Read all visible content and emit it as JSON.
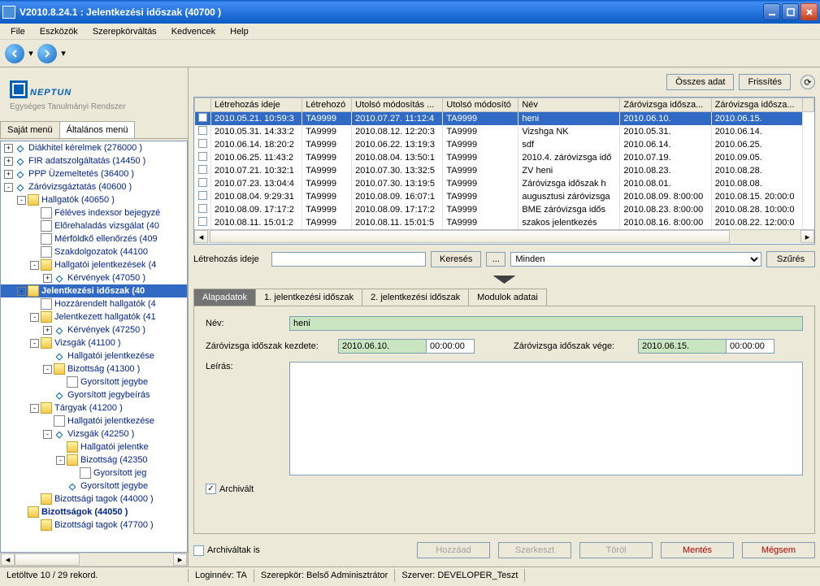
{
  "titlebar": {
    "title": "V2010.8.24.1 : Jelentkezési időszak (40700  )"
  },
  "menu": [
    "File",
    "Eszközök",
    "Szerepkörváltás",
    "Kedvencek",
    "Help"
  ],
  "logo": {
    "brand": "NEPTUN",
    "sub": "Egységes Tanulmányi Rendszer"
  },
  "lefttabs": [
    "Saját menü",
    "Általános menü"
  ],
  "tree": [
    {
      "indent": 0,
      "exp": "+",
      "ic": "blue",
      "label": "Diákhitel kérelmek (276000   )"
    },
    {
      "indent": 0,
      "exp": "+",
      "ic": "blue",
      "label": "FIR adatszolgáltatás (14450  )"
    },
    {
      "indent": 0,
      "exp": "+",
      "ic": "blue",
      "label": "PPP Üzemeltetés (36400  )"
    },
    {
      "indent": 0,
      "exp": "-",
      "ic": "blue",
      "label": "Záróvizsgáztatás (40600  )"
    },
    {
      "indent": 1,
      "exp": "-",
      "ic": "folder",
      "label": "Hallgatók (40650  )"
    },
    {
      "indent": 2,
      "exp": "",
      "ic": "doc",
      "label": "Féléves indexsor bejegyzé"
    },
    {
      "indent": 2,
      "exp": "",
      "ic": "doc",
      "label": "Előrehaladás vizsgálat (40"
    },
    {
      "indent": 2,
      "exp": "",
      "ic": "doc",
      "label": "Mérföldkő ellenőrzés (409"
    },
    {
      "indent": 2,
      "exp": "",
      "ic": "doc",
      "label": "Szakdolgozatok (44100"
    },
    {
      "indent": 2,
      "exp": "-",
      "ic": "folder",
      "label": "Hallgatói jelentkezések (4"
    },
    {
      "indent": 3,
      "exp": "+",
      "ic": "blue",
      "label": "Kérvények (47050  )"
    },
    {
      "indent": 1,
      "exp": "-",
      "ic": "folder",
      "label": "Jelentkezési időszak (40",
      "sel": true
    },
    {
      "indent": 2,
      "exp": "",
      "ic": "doc",
      "label": "Hozzárendelt hallgatók (4"
    },
    {
      "indent": 2,
      "exp": "-",
      "ic": "folder",
      "label": "Jelentkezett hallgatók (41"
    },
    {
      "indent": 3,
      "exp": "+",
      "ic": "blue",
      "label": "Kérvények (47250  )"
    },
    {
      "indent": 2,
      "exp": "-",
      "ic": "folder",
      "label": "Vizsgák (41100  )"
    },
    {
      "indent": 3,
      "exp": "",
      "ic": "blue",
      "label": "Hallgatói jelentkezése"
    },
    {
      "indent": 3,
      "exp": "-",
      "ic": "folder",
      "label": "Bizottság (41300  )"
    },
    {
      "indent": 4,
      "exp": "",
      "ic": "doc",
      "label": "Gyorsított jegybe"
    },
    {
      "indent": 3,
      "exp": "",
      "ic": "blue",
      "label": "Gyorsított jegybeírás"
    },
    {
      "indent": 2,
      "exp": "-",
      "ic": "folder",
      "label": "Tárgyak (41200  )"
    },
    {
      "indent": 3,
      "exp": "",
      "ic": "doc",
      "label": "Hallgatói jelentkezése"
    },
    {
      "indent": 3,
      "exp": "-",
      "ic": "blue",
      "label": "Vizsgák (42250  )"
    },
    {
      "indent": 4,
      "exp": "",
      "ic": "folder",
      "label": "Hallgatói jelentke"
    },
    {
      "indent": 4,
      "exp": "-",
      "ic": "folder",
      "label": "Bizottság (42350"
    },
    {
      "indent": 5,
      "exp": "",
      "ic": "doc",
      "label": "Gyorsított jeg"
    },
    {
      "indent": 4,
      "exp": "",
      "ic": "blue",
      "label": "Gyorsított jegybe"
    },
    {
      "indent": 2,
      "exp": "",
      "ic": "folder",
      "label": "Bizottsági tagok (44000  )"
    },
    {
      "indent": 1,
      "exp": "",
      "ic": "folder",
      "label": "Bizottságok (44050  )",
      "bold": true
    },
    {
      "indent": 2,
      "exp": "",
      "ic": "folder",
      "label": "Bizottsági tagok (47700  )"
    }
  ],
  "topbtns": {
    "all": "Összes adat",
    "refresh": "Frissítés"
  },
  "grid": {
    "headers": [
      "",
      "Létrehozás ideje",
      "Létrehozó",
      "Utolsó módosítás ...",
      "Utolsó módosító",
      "Név",
      "Záróvizsga idősza...",
      "Záróvizsga idősza..."
    ],
    "rows": [
      {
        "sel": true,
        "c": [
          "2010.05.21. 10:59:3",
          "TA9999",
          "2010.07.27. 11:12:4",
          "TA9999",
          "heni",
          "2010.06.10.",
          "2010.06.15."
        ]
      },
      {
        "c": [
          "2010.05.31. 14:33:2",
          "TA9999",
          "2010.08.12. 12:20:3",
          "TA9999",
          "Vizshga NK",
          "2010.05.31.",
          "2010.06.14."
        ]
      },
      {
        "c": [
          "2010.06.14. 18:20:2",
          "TA9999",
          "2010.06.22. 13:19:3",
          "TA9999",
          "sdf",
          "2010.06.14.",
          "2010.06.25."
        ]
      },
      {
        "c": [
          "2010.06.25. 11:43:2",
          "TA9999",
          "2010.08.04. 13:50:1",
          "TA9999",
          "2010.4. záróvizsga idő",
          "2010.07.19.",
          "2010.09.05."
        ]
      },
      {
        "c": [
          "2010.07.21. 10:32:1",
          "TA9999",
          "2010.07.30. 13:32:5",
          "TA9999",
          "ZV heni",
          "2010.08.23.",
          "2010.08.28."
        ]
      },
      {
        "c": [
          "2010.07.23. 13:04:4",
          "TA9999",
          "2010.07.30. 13:19:5",
          "TA9999",
          "Záróvizsga időszak h",
          "2010.08.01.",
          "2010.08.08."
        ]
      },
      {
        "c": [
          "2010.08.04. 9:29:31",
          "TA9999",
          "2010.08.09. 16:07:1",
          "TA9999",
          "augusztusi záróvizsga",
          "2010.08.09. 8:00:00",
          "2010.08.15. 20:00:0"
        ]
      },
      {
        "c": [
          "2010.08.09. 17:17:2",
          "TA9999",
          "2010.08.09. 17:17:2",
          "TA9999",
          "BME záróvizsga idős",
          "2010.08.23. 8:00:00",
          "2010.08.28. 10:00:0"
        ]
      },
      {
        "c": [
          "2010.08.11. 15:01:2",
          "TA9999",
          "2010.08.11. 15:01:5",
          "TA9999",
          "szakos jelentkezés",
          "2010.08.16. 8:00:00",
          "2010.08.22. 12:00:0"
        ]
      }
    ]
  },
  "search": {
    "label": "Létrehozás ideje",
    "btn": "Keresés",
    "ell": "...",
    "filter": "Minden",
    "szures": "Szűrés"
  },
  "dtabs": [
    "Alapadatok",
    "1. jelentkezési időszak",
    "2. jelentkezési időszak",
    "Modulok adatai"
  ],
  "form": {
    "nev_lbl": "Név:",
    "nev": "heni",
    "kezd_lbl": "Záróvizsga időszak kezdete:",
    "kezd_date": "2010.06.10.",
    "kezd_time": "00:00:00",
    "vege_lbl": "Záróvizsga időszak vége:",
    "vege_date": "2010.06.15.",
    "vege_time": "00:00:00",
    "leiras_lbl": "Leírás:",
    "leiras": "",
    "archivalt": "Archivált"
  },
  "bottom": {
    "archivaltak": "Archiváltak is",
    "hozzaad": "Hozzáad",
    "szerkeszt": "Szerkeszt",
    "torol": "Töröl",
    "mentes": "Mentés",
    "megsem": "Mégsem"
  },
  "status": {
    "left": "Letöltve 10 / 29 rekord.",
    "login": "Loginnév: TA",
    "role": "Szerepkör: Belső Adminisztrátor",
    "server": "Szerver: DEVELOPER_Teszt"
  }
}
